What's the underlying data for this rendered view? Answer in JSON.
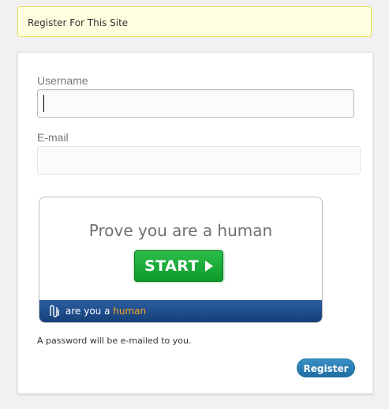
{
  "notice": {
    "text": "Register For This Site"
  },
  "form": {
    "username_label": "Username",
    "username_value": "",
    "email_label": "E-mail",
    "email_value": ""
  },
  "captcha": {
    "title": "Prove you are a human",
    "start_label": "START",
    "brand_prefix": "are you a ",
    "brand_accent": "human",
    "logo_icon": "ayah-logo-icon",
    "start_color": "#1aa83a",
    "footer_color": "#1f4d8c"
  },
  "password_note": "A password will be e-mailed to you.",
  "register_label": "Register",
  "colors": {
    "notice_bg": "#ffffe0",
    "notice_border": "#e6db55",
    "button_primary": "#2a82bb"
  }
}
